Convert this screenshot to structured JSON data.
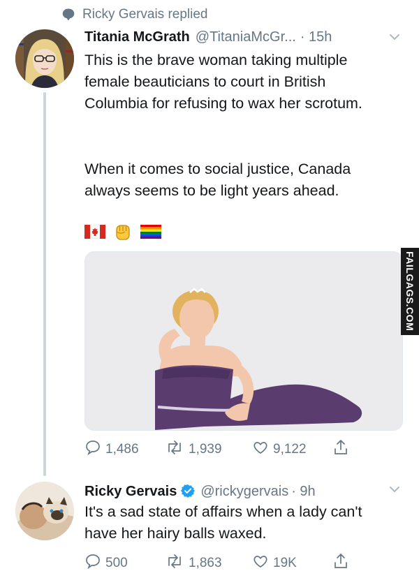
{
  "context": {
    "label": "Ricky Gervais replied"
  },
  "tweet1": {
    "name": "Titania McGrath",
    "handle": "@TitaniaMcGr...",
    "time": "· 15h",
    "paragraph1": "This is the brave woman taking multiple female beauticians to court in British Columbia for refusing to wax her scrotum.",
    "paragraph2": "When it comes to social justice, Canada always seems to be light years ahead.",
    "emojis": [
      "canadian-flag",
      "raised-fist",
      "rainbow-flag"
    ],
    "media": {
      "description_icon": "photo-woman-purple-gown"
    },
    "actions": {
      "replies": "1,486",
      "retweets": "1,939",
      "likes": "9,122"
    }
  },
  "tweet2": {
    "name": "Ricky Gervais",
    "verified": true,
    "handle": "@rickygervais",
    "time": "· 9h",
    "text": "It's a sad state of affairs when a lady can't have her hairy balls waxed.",
    "actions": {
      "replies": "500",
      "retweets": "1,863",
      "likes": "19K"
    }
  },
  "watermark": "FAILGAGS.COM",
  "colors": {
    "grey": "#657786",
    "line": "#ccd6dd",
    "verified": "#1da1f2",
    "gown": "#5a3d6e"
  }
}
